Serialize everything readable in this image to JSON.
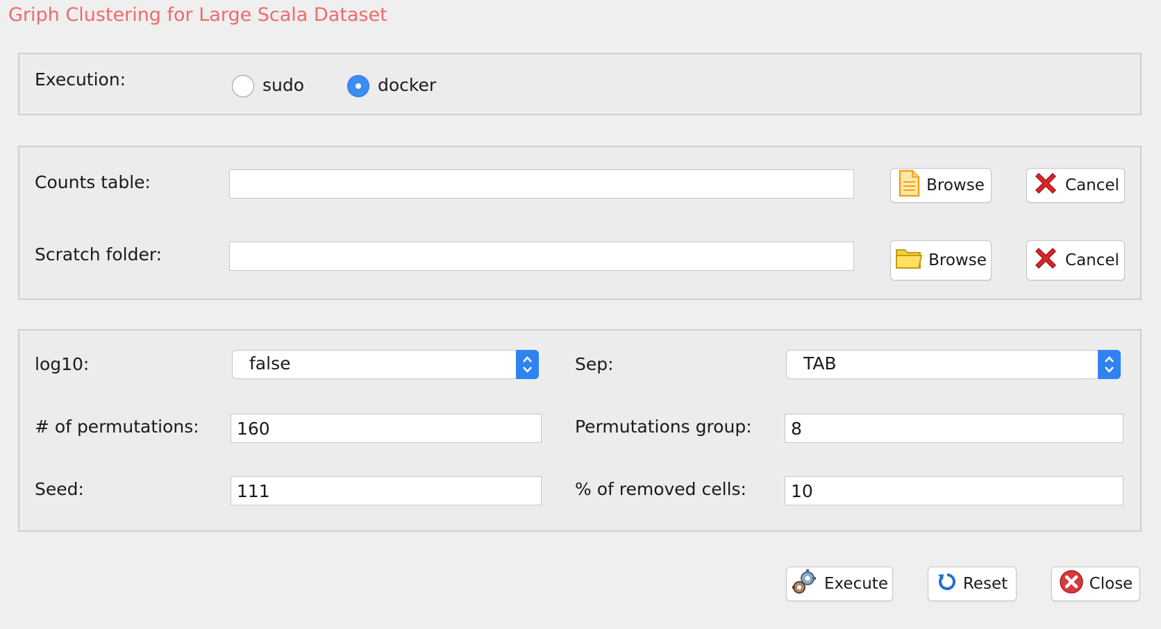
{
  "window": {
    "title": "Griph Clustering for Large Scala Dataset"
  },
  "execution": {
    "label": "Execution:",
    "options": [
      "sudo",
      "docker"
    ],
    "selected": "docker"
  },
  "files": {
    "counts_label": "Counts table:",
    "counts_value": "",
    "scratch_label": "Scratch folder:",
    "scratch_value": "",
    "browse_label": "Browse",
    "cancel_label": "Cancel"
  },
  "params": {
    "log10_label": "log10:",
    "log10_value": "false",
    "sep_label": "Sep:",
    "sep_value": "TAB",
    "permutations_label": "# of permutations:",
    "permutations_value": "160",
    "perm_group_label": "Permutations group:",
    "perm_group_value": "8",
    "seed_label": "Seed:",
    "seed_value": "111",
    "removed_cells_label": "% of removed cells:",
    "removed_cells_value": "10"
  },
  "actions": {
    "execute_label": "Execute",
    "reset_label": "Reset",
    "close_label": "Close"
  },
  "colors": {
    "title": "#f06a6a",
    "accent": "#2f82f2",
    "cancel_red": "#d9262b"
  },
  "icons": {
    "browse_counts": "document-icon",
    "browse_scratch": "folder-icon",
    "cancel": "red-x-icon",
    "execute": "gears-icon",
    "reset": "refresh-icon",
    "close": "close-circle-icon"
  }
}
